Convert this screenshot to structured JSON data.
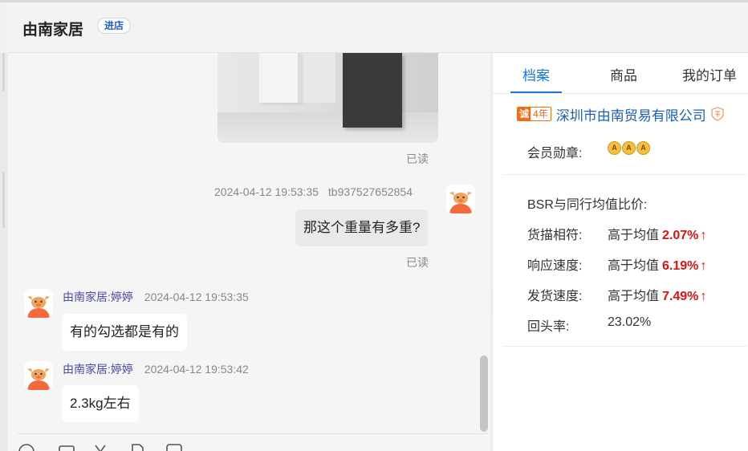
{
  "header": {
    "shop_name": "由南家居",
    "enter_store": "进店"
  },
  "chat": {
    "messages": [
      {
        "read_label": "已读"
      },
      {
        "timestamp": "2024-04-12 19:53:35",
        "user": "tb937527652854",
        "text": "那这个重量有多重?",
        "read_label": "已读"
      },
      {
        "nick": "由南家居:婷婷",
        "timestamp": "2024-04-12 19:53:35",
        "text": "有的勾选都是有的"
      },
      {
        "nick": "由南家居:婷婷",
        "timestamp": "2024-04-12 19:53:42",
        "text": "2.3kg左右"
      }
    ],
    "collapse_glyph": "»"
  },
  "sidebar": {
    "tabs": [
      "档案",
      "商品",
      "我的订单"
    ],
    "active_tab": 0,
    "company": {
      "badge_left": "诚",
      "badge_right": "4年",
      "name": "深圳市由南贸易有限公司"
    },
    "medals_label": "会员勋章:",
    "medal_glyph": "A",
    "bsr_title": "BSR与同行均值比价:",
    "stats": [
      {
        "label": "货描相符:",
        "prefix": "高于均值",
        "pct": "2.07%",
        "arrow": "↑"
      },
      {
        "label": "响应速度:",
        "prefix": "高于均值",
        "pct": "6.19%",
        "arrow": "↑"
      },
      {
        "label": "发货速度:",
        "prefix": "高于均值",
        "pct": "7.49%",
        "arrow": "↑"
      }
    ],
    "return_rate": {
      "label": "回头率:",
      "value": "23.02%"
    }
  },
  "colors": {
    "accent": "#1a78d6",
    "highlight": "#e01010",
    "badge": "#f26a1b"
  }
}
